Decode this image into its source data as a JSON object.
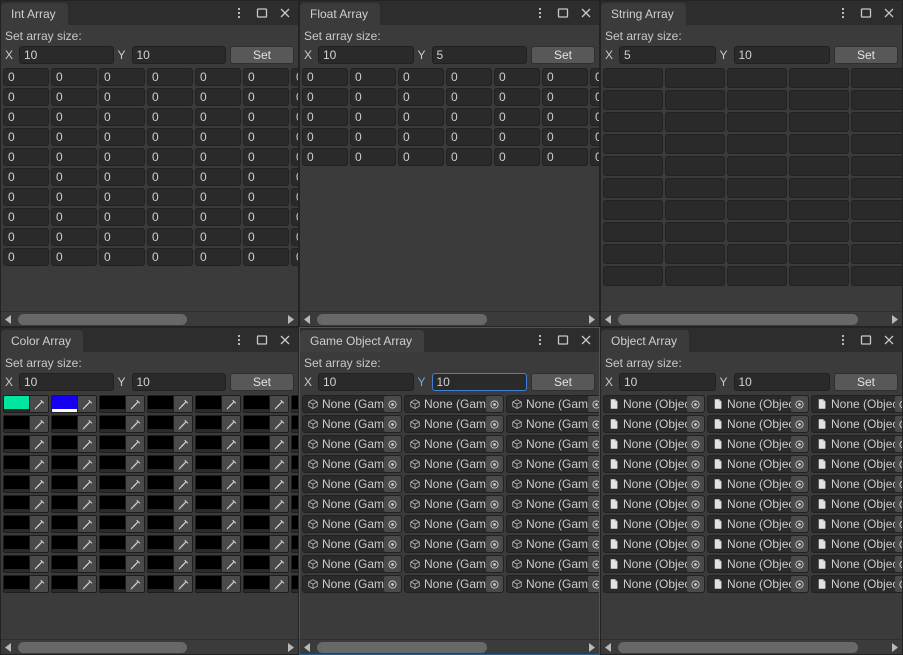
{
  "theme": {
    "window_bg": "#383838",
    "panel_bg": "#3b3b3b",
    "titlebar_bg": "#2d2d2d",
    "field_bg": "#2a2a2a",
    "button_bg": "#585858",
    "focus_accent": "#3b7bb5",
    "text": "#c9c9c9"
  },
  "common": {
    "set_array_size_label": "Set array size:",
    "x_label": "X",
    "y_label": "Y",
    "set_button_label": "Set",
    "menu_icon": "kebab-menu-icon",
    "maximize_icon": "maximize-icon",
    "close_icon": "close-icon",
    "scroll_left_icon": "arrow-left-icon",
    "scroll_right_icon": "arrow-right-icon"
  },
  "panels": [
    {
      "id": "int-array",
      "title": "Int Array",
      "focused": false,
      "size_x": "10",
      "size_y": "10",
      "active_field": "none",
      "cell_type": "int",
      "rows": 10,
      "cols": 7,
      "cell_value": "0",
      "scrollbar": {
        "thumb_start_pct": 1,
        "thumb_width_pct": 63
      }
    },
    {
      "id": "float-array",
      "title": "Float Array",
      "focused": false,
      "size_x": "10",
      "size_y": "5",
      "active_field": "none",
      "cell_type": "int",
      "rows": 5,
      "cols": 7,
      "cell_value": "0",
      "scrollbar": {
        "thumb_start_pct": 1,
        "thumb_width_pct": 63
      }
    },
    {
      "id": "string-array",
      "title": "String Array",
      "focused": false,
      "size_x": "5",
      "size_y": "10",
      "active_field": "none",
      "cell_type": "string",
      "rows": 10,
      "cols": 5,
      "cell_value": "",
      "scrollbar": {
        "thumb_start_pct": 1,
        "thumb_width_pct": 88
      }
    },
    {
      "id": "color-array",
      "title": "Color Array",
      "focused": false,
      "size_x": "10",
      "size_y": "10",
      "active_field": "none",
      "cell_type": "color",
      "rows": 10,
      "cols": 7,
      "cell_value": "#000000",
      "eyedropper_icon": "eyedropper-icon",
      "colors": {
        "0,0": "#00e5a0",
        "0,1": "#1500f0"
      },
      "alpha_bars": {
        "0,1": "#ffffff"
      },
      "scrollbar": {
        "thumb_start_pct": 1,
        "thumb_width_pct": 63
      }
    },
    {
      "id": "game-object-array",
      "title": "Game Object Array",
      "focused": true,
      "size_x": "10",
      "size_y": "10",
      "active_field": "y",
      "cell_type": "object",
      "rows": 10,
      "cols": 3,
      "cell_value": "None (Game Object)",
      "object_icon": "cube-icon",
      "picker_icon": "object-picker-icon",
      "scrollbar": {
        "thumb_start_pct": 1,
        "thumb_width_pct": 63
      }
    },
    {
      "id": "object-array",
      "title": "Object Array",
      "focused": false,
      "size_x": "10",
      "size_y": "10",
      "active_field": "none",
      "cell_type": "object",
      "rows": 10,
      "cols": 3,
      "cell_value": "None (Object)",
      "object_icon": "document-icon",
      "picker_icon": "object-picker-icon",
      "scrollbar": {
        "thumb_start_pct": 1,
        "thumb_width_pct": 88
      }
    }
  ]
}
